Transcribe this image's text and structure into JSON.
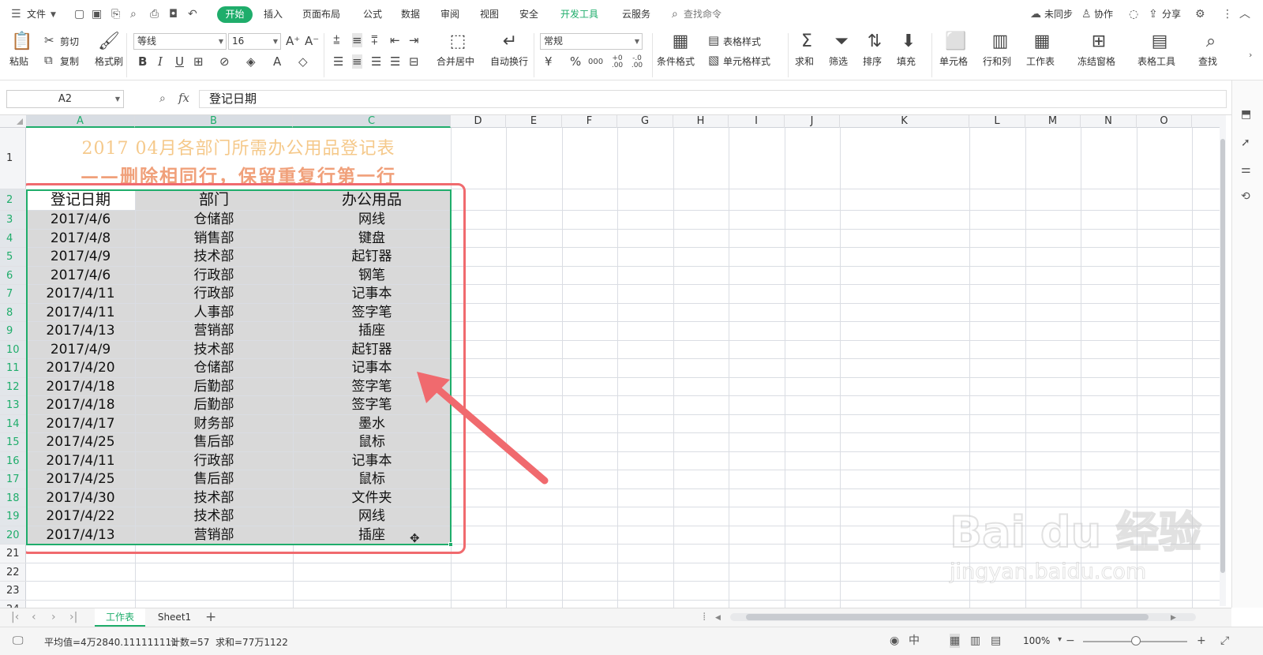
{
  "menubar": {
    "file": "文件",
    "tabs": [
      "开始",
      "插入",
      "页面布局",
      "公式",
      "数据",
      "审阅",
      "视图",
      "安全",
      "开发工具",
      "云服务"
    ],
    "active_tab": "开始",
    "search": "查找命令",
    "right": {
      "sync": "未同步",
      "collab": "协作",
      "share": "分享"
    }
  },
  "ribbon": {
    "paste": "粘贴",
    "cut": "剪切",
    "copy": "复制",
    "format_painter": "格式刷",
    "font_name": "等线",
    "font_size": "16",
    "bold": "B",
    "italic": "I",
    "underline": "U",
    "font_color_glyph": "A",
    "merge_center": "合并居中",
    "wrap_text": "自动换行",
    "number_format": "常规",
    "currency": "¥",
    "percent": "%",
    "thousands": "000",
    "inc_decimal": "+0 .00",
    "dec_decimal": "-.0 .00",
    "conditional_format": "条件格式",
    "table_style": "表格样式",
    "cell_style": "单元格样式",
    "sum": "求和",
    "filter": "筛选",
    "sort": "排序",
    "fill": "填充",
    "cell": "单元格",
    "row_col": "行和列",
    "worksheet": "工作表",
    "freeze": "冻结窗格",
    "table_tools": "表格工具",
    "find": "查找"
  },
  "formula_bar": {
    "name_box": "A2",
    "fx": "fx",
    "content": "登记日期"
  },
  "columns": [
    "A",
    "B",
    "C",
    "D",
    "E",
    "F",
    "G",
    "H",
    "I",
    "J",
    "K",
    "L",
    "M",
    "N",
    "O"
  ],
  "rows": [
    "1",
    "2",
    "3",
    "4",
    "5",
    "6",
    "7",
    "8",
    "9",
    "10",
    "11",
    "12",
    "13",
    "14",
    "15",
    "16",
    "17",
    "18",
    "19",
    "20",
    "21",
    "22",
    "23",
    "24"
  ],
  "sheet": {
    "title_line1": "2017 04月各部门所需办公用品登记表",
    "title_line2": "——删除相同行，保留重复行第一行",
    "headers": [
      "登记日期",
      "部门",
      "办公用品"
    ],
    "data": [
      [
        "2017/4/6",
        "仓储部",
        "网线"
      ],
      [
        "2017/4/8",
        "销售部",
        "键盘"
      ],
      [
        "2017/4/9",
        "技术部",
        "起钉器"
      ],
      [
        "2017/4/6",
        "行政部",
        "钢笔"
      ],
      [
        "2017/4/11",
        "行政部",
        "记事本"
      ],
      [
        "2017/4/11",
        "人事部",
        "签字笔"
      ],
      [
        "2017/4/13",
        "营销部",
        "插座"
      ],
      [
        "2017/4/9",
        "技术部",
        "起钉器"
      ],
      [
        "2017/4/20",
        "仓储部",
        "记事本"
      ],
      [
        "2017/4/18",
        "后勤部",
        "签字笔"
      ],
      [
        "2017/4/18",
        "后勤部",
        "签字笔"
      ],
      [
        "2017/4/17",
        "财务部",
        "墨水"
      ],
      [
        "2017/4/25",
        "售后部",
        "鼠标"
      ],
      [
        "2017/4/11",
        "行政部",
        "记事本"
      ],
      [
        "2017/4/25",
        "售后部",
        "鼠标"
      ],
      [
        "2017/4/30",
        "技术部",
        "文件夹"
      ],
      [
        "2017/4/22",
        "技术部",
        "网线"
      ],
      [
        "2017/4/13",
        "营销部",
        "插座"
      ]
    ]
  },
  "sheet_tabs": {
    "tabs": [
      "工作表",
      "Sheet1"
    ],
    "active": "工作表",
    "add": "+"
  },
  "status": {
    "average": "平均值=4万2840.111111111",
    "count": "计数=57",
    "sum": "求和=77万1122",
    "zoom": "100%"
  },
  "watermark": {
    "brand": "Bai du 经验",
    "url": "jingyan.baidu.com"
  },
  "colors": {
    "accent": "#1fad6b",
    "selection_fill": "#d9d9d9",
    "annotation": "#f06a6e"
  }
}
